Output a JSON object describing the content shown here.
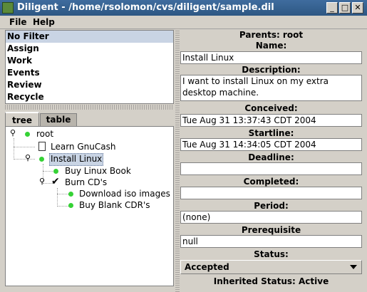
{
  "window": {
    "title": "Diligent - /home/rsolomon/cvs/diligent/sample.dil",
    "minimize_glyph": "_",
    "maximize_glyph": "□",
    "close_glyph": "✕"
  },
  "menubar": {
    "file": "File",
    "help": "Help"
  },
  "filters": [
    "No Filter",
    "Assign",
    "Work",
    "Events",
    "Review",
    "Recycle"
  ],
  "tabs": {
    "tree": "tree",
    "table": "table"
  },
  "tree": {
    "root": "root",
    "learn_gnucash": "Learn GnuCash",
    "install_linux": "Install Linux",
    "buy_linux_book": "Buy Linux Book",
    "burn_cds": "Burn CD's",
    "download_iso": "Download iso images",
    "buy_blank_cdrs": "Buy Blank CDR's"
  },
  "details": {
    "parents_label": "Parents: root",
    "name_label": "Name:",
    "name_value": "Install Linux",
    "description_label": "Description:",
    "description_value": "I want to install Linux on my extra desktop machine.",
    "conceived_label": "Conceived:",
    "conceived_value": "Tue Aug 31 13:37:43 CDT 2004",
    "startline_label": "Startline:",
    "startline_value": "Tue Aug 31 14:34:05 CDT 2004",
    "deadline_label": "Deadline:",
    "deadline_value": "",
    "completed_label": "Completed:",
    "completed_value": "",
    "period_label": "Period:",
    "period_value": "(none)",
    "prerequisite_label": "Prerequisite",
    "prerequisite_value": "null",
    "status_label": "Status:",
    "status_value": "Accepted",
    "inherited_status": "Inherited Status: Active"
  }
}
